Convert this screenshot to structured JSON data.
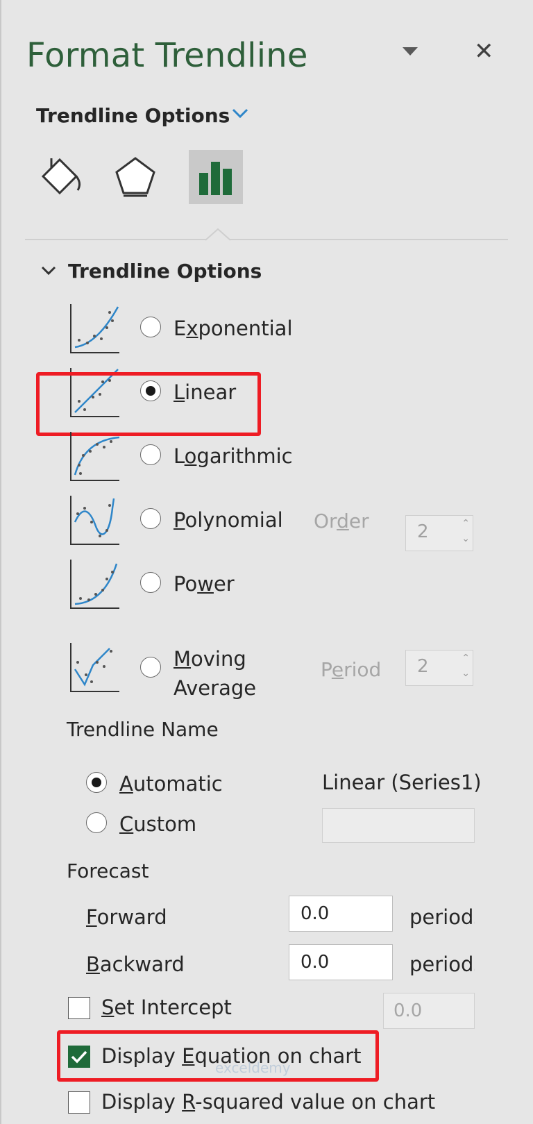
{
  "pane": {
    "title": "Format Trendline",
    "subtitle": "Trendline Options",
    "section_title": "Trendline Options"
  },
  "icons": {
    "menu": "dropdown-triangle-icon",
    "close": "close-icon",
    "tabs": [
      "fill-line-bucket-icon",
      "effects-pentagon-icon",
      "trendline-options-bars-icon"
    ],
    "chevron": "chevron-down-icon",
    "check": "checkmark-icon"
  },
  "colors": {
    "accent_green": "#1f6b3a",
    "title_green": "#2e5f3a",
    "trend_blue": "#2e86c9",
    "highlight_red": "#ee1c24"
  },
  "trend_types": [
    {
      "pre": "E",
      "u": "x",
      "post": "ponential",
      "selected": false
    },
    {
      "pre": "",
      "u": "L",
      "post": "inear",
      "selected": true
    },
    {
      "pre": "L",
      "u": "o",
      "post": "garithmic",
      "selected": false
    },
    {
      "pre": "",
      "u": "P",
      "post": "olynomial",
      "selected": false
    },
    {
      "pre": "Po",
      "u": "w",
      "post": "er",
      "selected": false
    },
    {
      "pre": "",
      "u": "M",
      "post": "oving",
      "line2": "Average",
      "selected": false
    }
  ],
  "order": {
    "pre": "Or",
    "u": "d",
    "post": "er",
    "value": "2"
  },
  "period": {
    "pre": "P",
    "u": "e",
    "post": "riod",
    "value": "2"
  },
  "trendline_name": {
    "heading": "Trendline Name",
    "automatic": {
      "u": "A",
      "post": "utomatic",
      "selected": true
    },
    "auto_value": "Linear (Series1)",
    "custom": {
      "u": "C",
      "post": "ustom",
      "selected": false
    },
    "custom_value": ""
  },
  "forecast": {
    "heading": "Forecast",
    "forward": {
      "u": "F",
      "post": "orward",
      "value": "0.0",
      "unit": "periods"
    },
    "backward": {
      "u": "B",
      "post": "ackward",
      "value": "0.0",
      "unit": "periods"
    }
  },
  "set_intercept": {
    "u": "S",
    "post": "et Intercept",
    "checked": false,
    "value": "0.0"
  },
  "display_equation": {
    "pre": "Display ",
    "u": "E",
    "post": "quation on chart",
    "checked": true
  },
  "display_r2": {
    "pre": "Display ",
    "u": "R",
    "post": "-squared value on chart",
    "checked": false
  },
  "watermark": "exceldemy"
}
